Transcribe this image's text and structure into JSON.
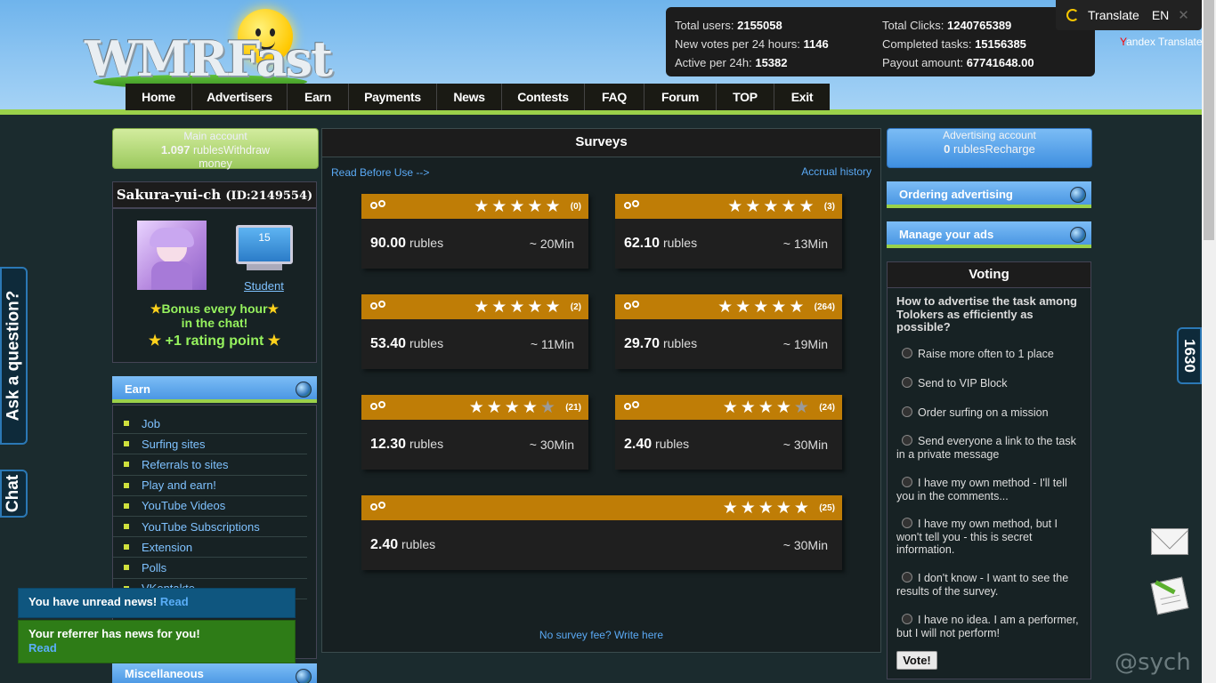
{
  "header": {
    "logo_text": "WMRFast",
    "nav": [
      "Home",
      "Advertisers",
      "Earn",
      "Payments",
      "News",
      "Contests",
      "FAQ",
      "Forum",
      "TOP",
      "Exit"
    ],
    "stats": {
      "total_users_label": "Total users:",
      "total_users": "2155058",
      "new_votes_label": "New votes per 24 hours:",
      "new_votes": "1146",
      "active_label": "Active per 24h:",
      "active": "15382",
      "total_clicks_label": "Total Clicks:",
      "total_clicks": "1240765389",
      "completed_label": "Completed tasks:",
      "completed": "15156385",
      "payout_label": "Payout amount:",
      "payout": "67741648.00"
    },
    "translate": {
      "label": "Translate",
      "lang": "EN",
      "yandex_y": "Y",
      "yandex_rest": "andex Translate"
    }
  },
  "left": {
    "main_account": {
      "label": "Main account",
      "amount": "1.097",
      "unit": "rubles",
      "action": "Withdraw",
      "action2": "money"
    },
    "user": {
      "name": "Sakura-yui-ch",
      "id": "(ID:2149554)",
      "level": "15",
      "status": "Student"
    },
    "bonus": {
      "line1": "Bonus every hour",
      "line2": "in the chat!",
      "line3": "+1 rating point"
    },
    "earn": {
      "title": "Earn",
      "items": [
        "Job",
        "Surfing sites",
        "Referrals to sites",
        "Play and earn!",
        "YouTube Videos",
        "YouTube Subscriptions",
        "Extension",
        "Polls",
        "VKontakte"
      ]
    },
    "misc_title": "Miscellaneous"
  },
  "center": {
    "title": "Surveys",
    "read_before": "Read Before Use -->",
    "accrual": "Accrual history",
    "unit": "rubles",
    "cards": [
      {
        "price": "90.00",
        "time": "~ 20Min",
        "count": "(0)",
        "rating": 5
      },
      {
        "price": "62.10",
        "time": "~ 13Min",
        "count": "(3)",
        "rating": 5
      },
      {
        "price": "53.40",
        "time": "~ 11Min",
        "count": "(2)",
        "rating": 5
      },
      {
        "price": "29.70",
        "time": "~ 19Min",
        "count": "(264)",
        "rating": 5
      },
      {
        "price": "12.30",
        "time": "~ 30Min",
        "count": "(21)",
        "rating": 4.5
      },
      {
        "price": "2.40",
        "time": "~ 30Min",
        "count": "(24)",
        "rating": 4.5
      },
      {
        "price": "2.40",
        "time": "~ 30Min",
        "count": "(25)",
        "rating": 5
      }
    ],
    "footer_link": "No survey fee? Write here"
  },
  "right": {
    "ad_account": {
      "label": "Advertising account",
      "amount": "0",
      "unit": "rubles",
      "action": "Recharge"
    },
    "ordering": "Ordering advertising",
    "manage": "Manage your ads",
    "voting": {
      "title": "Voting",
      "question": "How to advertise the task among Tolokers as efficiently as possible?",
      "options": [
        "Raise more often to 1 place",
        "Send to VIP Block",
        "Order surfing on a mission",
        "Send everyone a link to the task in a private message",
        "I have my own method - I'll tell you in the comments...",
        "I have my own method, but I won't tell you - this is secret information.",
        "I don't know - I want to see the results of the survey.",
        "I have no idea. I am a performer, but I will not perform!"
      ],
      "button": "Vote!"
    }
  },
  "side": {
    "ask": "Ask a question?",
    "chat": "Chat",
    "counter": "1630",
    "watermark": "@sych"
  },
  "toasts": {
    "news": "You have unread news!",
    "read": "Read",
    "referrer": "Your referrer has news for you!",
    "read2": "Read"
  }
}
